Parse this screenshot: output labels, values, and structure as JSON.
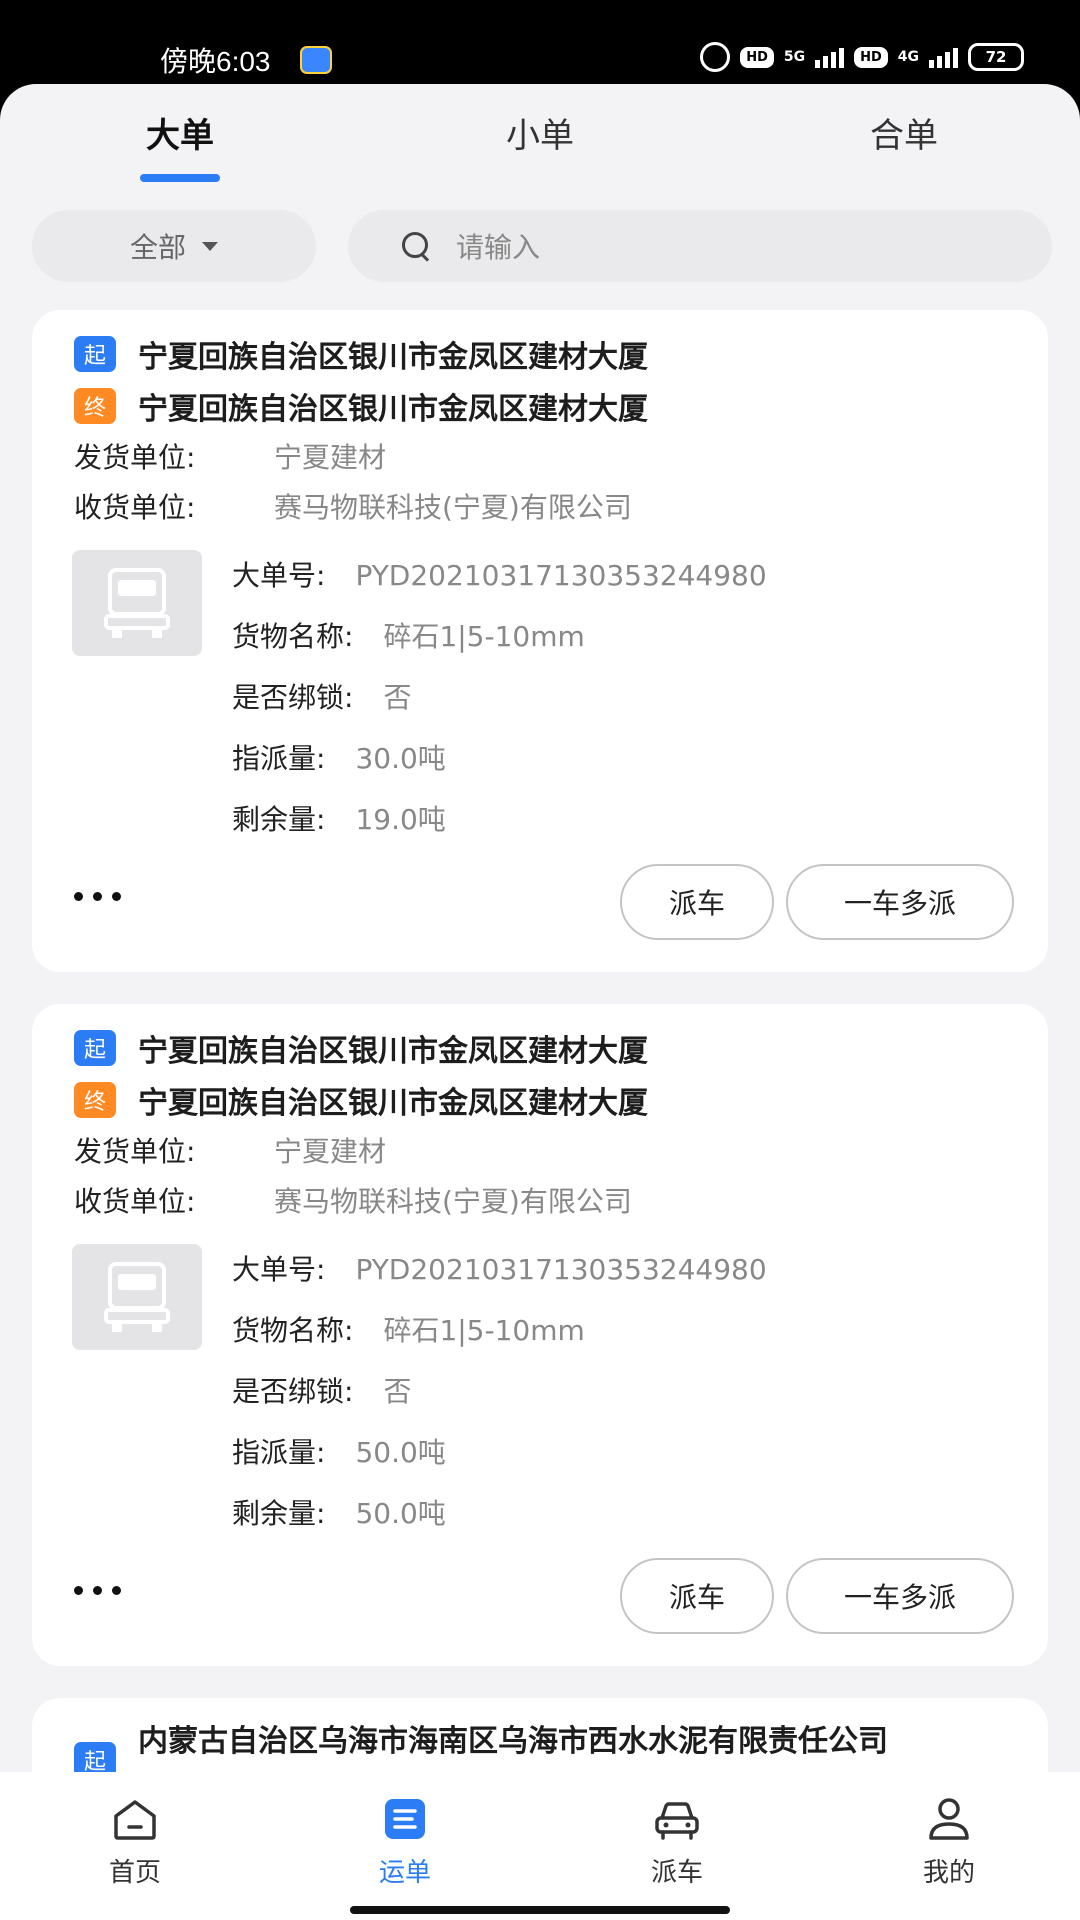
{
  "status_bar": {
    "time": "傍晚6:03",
    "hd1": "HD",
    "net1": "5G",
    "hd2": "HD",
    "net2": "4G",
    "battery": "72"
  },
  "tabs": [
    {
      "label": "大单",
      "active": true
    },
    {
      "label": "小单",
      "active": false
    },
    {
      "label": "合单",
      "active": false
    }
  ],
  "filter": {
    "selected": "全部"
  },
  "search": {
    "placeholder": "请输入"
  },
  "labels": {
    "start_badge": "起",
    "end_badge": "终",
    "sender": "发货单位:",
    "receiver": "收货单位:",
    "order_no": "大单号:",
    "goods": "货物名称:",
    "lock": "是否绑锁:",
    "assigned": "指派量:",
    "remaining": "剩余量:",
    "dispatch_btn": "派车",
    "multi_btn": "一车多派"
  },
  "orders": [
    {
      "start": "宁夏回族自治区银川市金凤区建材大厦",
      "end": "宁夏回族自治区银川市金凤区建材大厦",
      "sender": "宁夏建材",
      "receiver": "赛马物联科技(宁夏)有限公司",
      "order_no": "PYD20210317130353244980",
      "goods": "碎石1|5-10mm",
      "lock": "否",
      "assigned": "30.0吨",
      "remaining": "19.0吨"
    },
    {
      "start": "宁夏回族自治区银川市金凤区建材大厦",
      "end": "宁夏回族自治区银川市金凤区建材大厦",
      "sender": "宁夏建材",
      "receiver": "赛马物联科技(宁夏)有限公司",
      "order_no": "PYD20210317130353244980",
      "goods": "碎石1|5-10mm",
      "lock": "否",
      "assigned": "50.0吨",
      "remaining": "50.0吨"
    },
    {
      "start": "内蒙古自治区乌海市海南区乌海市西水水泥有限责任公司"
    }
  ],
  "nav": [
    {
      "label": "首页",
      "icon": "home-icon",
      "active": false
    },
    {
      "label": "运单",
      "icon": "waybill-icon",
      "active": true
    },
    {
      "label": "派车",
      "icon": "car-icon",
      "active": false
    },
    {
      "label": "我的",
      "icon": "profile-icon",
      "active": false
    }
  ],
  "colors": {
    "accent": "#2b7cf5",
    "start_badge": "#2b7cf5",
    "end_badge": "#ff8a24"
  }
}
